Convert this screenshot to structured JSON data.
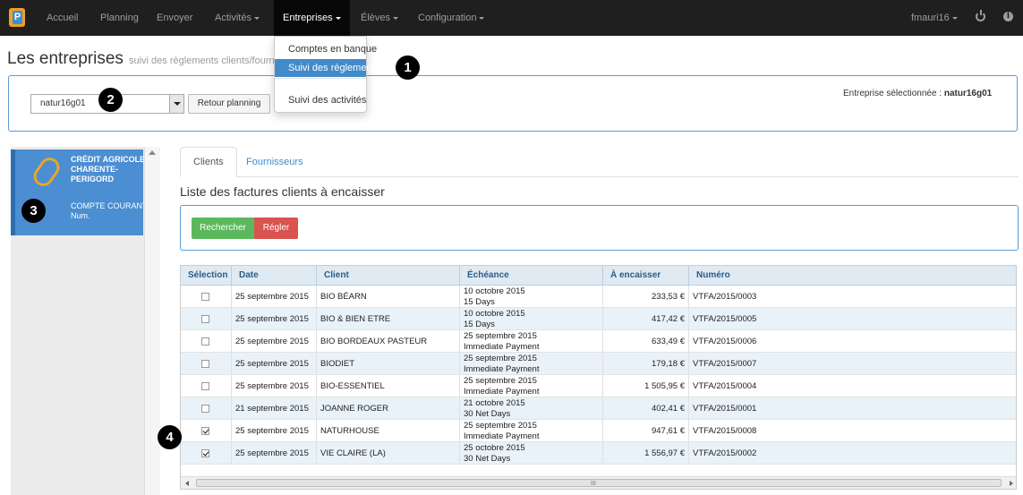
{
  "navbar": {
    "logo_letter": "P",
    "items": [
      "Accueil",
      "Planning",
      "Envoyer",
      "Activités",
      "Entreprises",
      "Élèves",
      "Configuration"
    ],
    "user": "fmauri16"
  },
  "dropdown": {
    "items": [
      "Comptes en banque",
      "Suivi des règlements",
      "Suivi des activités"
    ]
  },
  "page": {
    "title": "Les entreprises",
    "subtitle": "suivi des règlements clients/fournisseurs"
  },
  "selection": {
    "company_value": "natur16g01",
    "back_button": "Retour planning",
    "selected_label": "Entreprise sélectionnée :",
    "selected_value": "natur16g01"
  },
  "bank": {
    "name": "CRÉDIT AGRICOLE CHARENTE-PERIGORD",
    "account": "COMPTE COURANT Num."
  },
  "tabs": [
    "Clients",
    "Fournisseurs"
  ],
  "list_title": "Liste des factures clients à encaisser",
  "actions": {
    "search": "Rechercher",
    "pay": "Régler"
  },
  "markers": [
    "1",
    "2",
    "3",
    "4"
  ],
  "table": {
    "headers": [
      "Sélection",
      "Date",
      "Client",
      "Échéance",
      "À encaisser",
      "Numéro"
    ],
    "rows": [
      {
        "checked": false,
        "date": "25 septembre 2015",
        "client": "BIO BÉARN",
        "due_date": "10 octobre 2015",
        "terms": "15 Days",
        "amount": "233,53 €",
        "number": "VTFA/2015/0003"
      },
      {
        "checked": false,
        "date": "25 septembre 2015",
        "client": "BIO & BIEN ETRE",
        "due_date": "10 octobre 2015",
        "terms": "15 Days",
        "amount": "417,42 €",
        "number": "VTFA/2015/0005"
      },
      {
        "checked": false,
        "date": "25 septembre 2015",
        "client": "BIO BORDEAUX PASTEUR",
        "due_date": "25 septembre 2015",
        "terms": "Immediate Payment",
        "amount": "633,49 €",
        "number": "VTFA/2015/0006"
      },
      {
        "checked": false,
        "date": "25 septembre 2015",
        "client": "BIODIET",
        "due_date": "25 septembre 2015",
        "terms": "Immediate Payment",
        "amount": "179,18 €",
        "number": "VTFA/2015/0007"
      },
      {
        "checked": false,
        "date": "25 septembre 2015",
        "client": "BIO-ESSENTIEL",
        "due_date": "25 septembre 2015",
        "terms": "Immediate Payment",
        "amount": "1 505,95 €",
        "number": "VTFA/2015/0004"
      },
      {
        "checked": false,
        "date": "21 septembre 2015",
        "client": "JOANNE ROGER",
        "due_date": "21 octobre 2015",
        "terms": "30 Net Days",
        "amount": "402,41 €",
        "number": "VTFA/2015/0001"
      },
      {
        "checked": true,
        "date": "25 septembre 2015",
        "client": "NATURHOUSE",
        "due_date": "25 septembre 2015",
        "terms": "Immediate Payment",
        "amount": "947,61 €",
        "number": "VTFA/2015/0008"
      },
      {
        "checked": true,
        "date": "25 septembre 2015",
        "client": "VIE CLAIRE (LA)",
        "due_date": "25 octobre 2015",
        "terms": "30 Net Days",
        "amount": "1 556,97 €",
        "number": "VTFA/2015/0002"
      }
    ]
  },
  "scroll_grip": "III"
}
